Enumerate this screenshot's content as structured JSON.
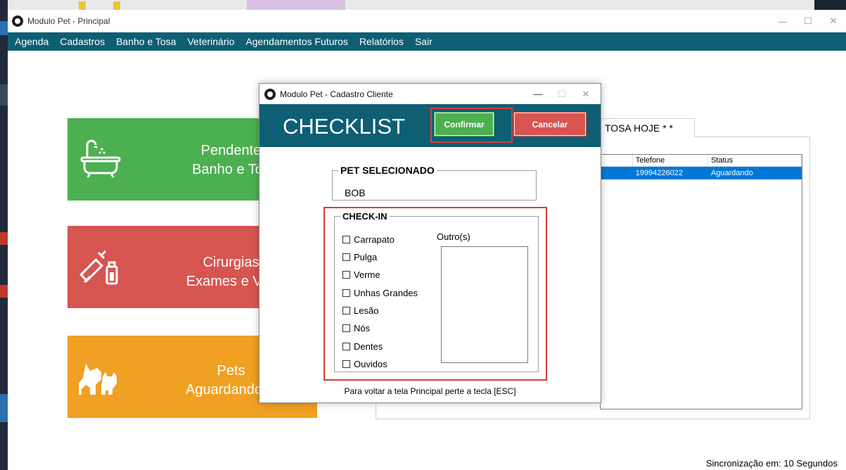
{
  "main_window": {
    "title": "Modulo Pet - Principal",
    "controls": {
      "minimize": "—",
      "maximize": "☐",
      "close": "✕"
    }
  },
  "menu": {
    "items": [
      "Agenda",
      "Cadastros",
      "Banho e Tosa",
      "Veterinário",
      "Agendamentos Futuros",
      "Relatórios",
      "Sair"
    ]
  },
  "tiles": {
    "banho": {
      "line1": "Pendente",
      "line2": "Banho e Tos"
    },
    "cirurgias": {
      "line1": "Cirurgias",
      "line2": "Exames e Vac"
    },
    "pets": {
      "line1": "Pets",
      "line2": "Aguardando D"
    }
  },
  "tab": {
    "label": "TOSA HOJE * *"
  },
  "list": {
    "columns": [
      "",
      "Telefone",
      "Status"
    ],
    "rows": [
      {
        "col1": "",
        "telefone": "19994226022",
        "status": "Aguardando"
      }
    ]
  },
  "status_bar": {
    "sync_text": "Sincronização em: 10 Segundos"
  },
  "dialog": {
    "title": "Modulo Pet - Cadastro Cliente",
    "controls": {
      "minimize": "—",
      "maximize": "☐",
      "close": "✕"
    },
    "heading": "CHECKLIST",
    "confirm_label": "Confirmar",
    "cancel_label": "Cancelar",
    "pet_group_label": "PET SELECIONADO",
    "pet_name": "BOB",
    "checkin_group_label": "CHECK-IN",
    "checkin_items": [
      "Carrapato",
      "Pulga",
      "Verme",
      "Unhas Grandes",
      "Lesão",
      "Nós",
      "Dentes",
      "Ouvidos"
    ],
    "outros_label": "Outro(s)",
    "outros_value": "",
    "esc_hint": "Para voltar a tela Principal perte a tecla [ESC]"
  },
  "colors": {
    "header_teal": "#0e5e74",
    "green": "#4caf50",
    "red": "#d75550",
    "orange": "#f0a022",
    "selection_blue": "#0078d7",
    "highlight_red": "#d93a3a"
  }
}
